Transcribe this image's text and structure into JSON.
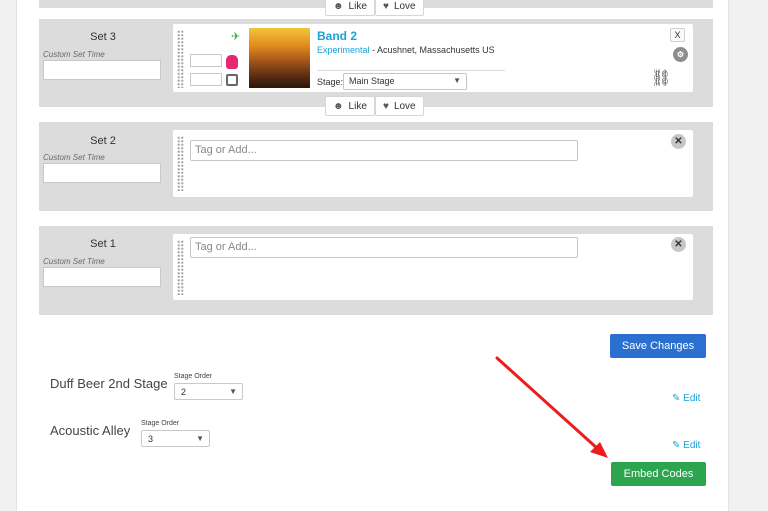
{
  "reactions": {
    "like_label": "Like",
    "love_label": "Love"
  },
  "sets": [
    {
      "label": "Set 3",
      "custom_time_label": "Custom Set Time",
      "band": {
        "name": "Band 2",
        "genre": "Experimental",
        "location": " - Acushnet, Massachusetts US",
        "stage_label": "Stage:",
        "stage_value": "Main Stage",
        "remove_label": "X"
      }
    },
    {
      "label": "Set 2",
      "custom_time_label": "Custom Set Time",
      "tag_placeholder": "Tag or Add..."
    },
    {
      "label": "Set 1",
      "custom_time_label": "Custom Set Time",
      "tag_placeholder": "Tag or Add..."
    }
  ],
  "save_changes_label": "Save Changes",
  "stages": [
    {
      "name": "Duff Beer 2nd Stage",
      "order_label": "Stage Order",
      "order_value": "2",
      "edit_label": "Edit"
    },
    {
      "name": "Acoustic Alley",
      "order_label": "Stage Order",
      "order_value": "3",
      "edit_label": "Edit"
    }
  ],
  "embed_codes_label": "Embed Codes",
  "colors": {
    "accent_blue": "#2b6fd1",
    "accent_green": "#2da44e",
    "link": "#1aa3d6",
    "arrow": "#ee1c1c"
  }
}
